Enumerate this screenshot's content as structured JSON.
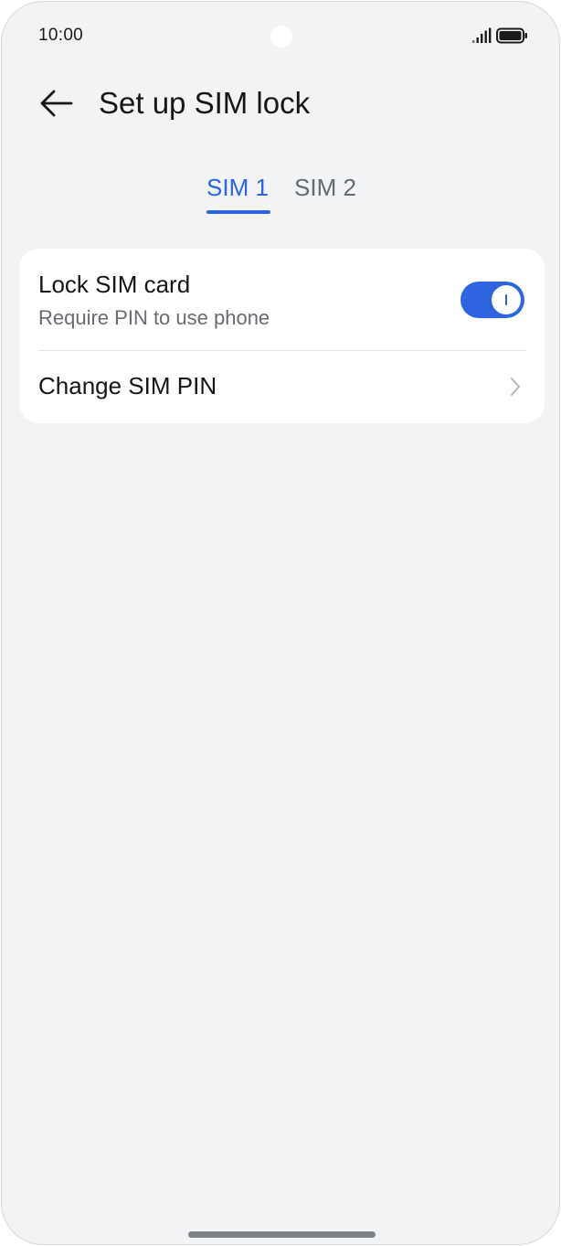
{
  "status_bar": {
    "time": "10:00",
    "icons": [
      "signal-icon",
      "battery-icon"
    ]
  },
  "header": {
    "back_icon": "arrow-left-icon",
    "title": "Set up SIM lock"
  },
  "tabs": [
    {
      "label": "SIM 1",
      "selected": true
    },
    {
      "label": "SIM 2",
      "selected": false
    }
  ],
  "settings": {
    "lock_sim": {
      "title": "Lock SIM card",
      "subtitle": "Require PIN to use phone",
      "toggle_on": true
    },
    "change_pin": {
      "title": "Change SIM PIN",
      "icon": "chevron-right-icon"
    }
  },
  "colors": {
    "accent": "#2f64e0",
    "background": "#f1f3f5",
    "card": "#ffffff",
    "text_primary": "#161616",
    "text_secondary": "#686b70"
  }
}
